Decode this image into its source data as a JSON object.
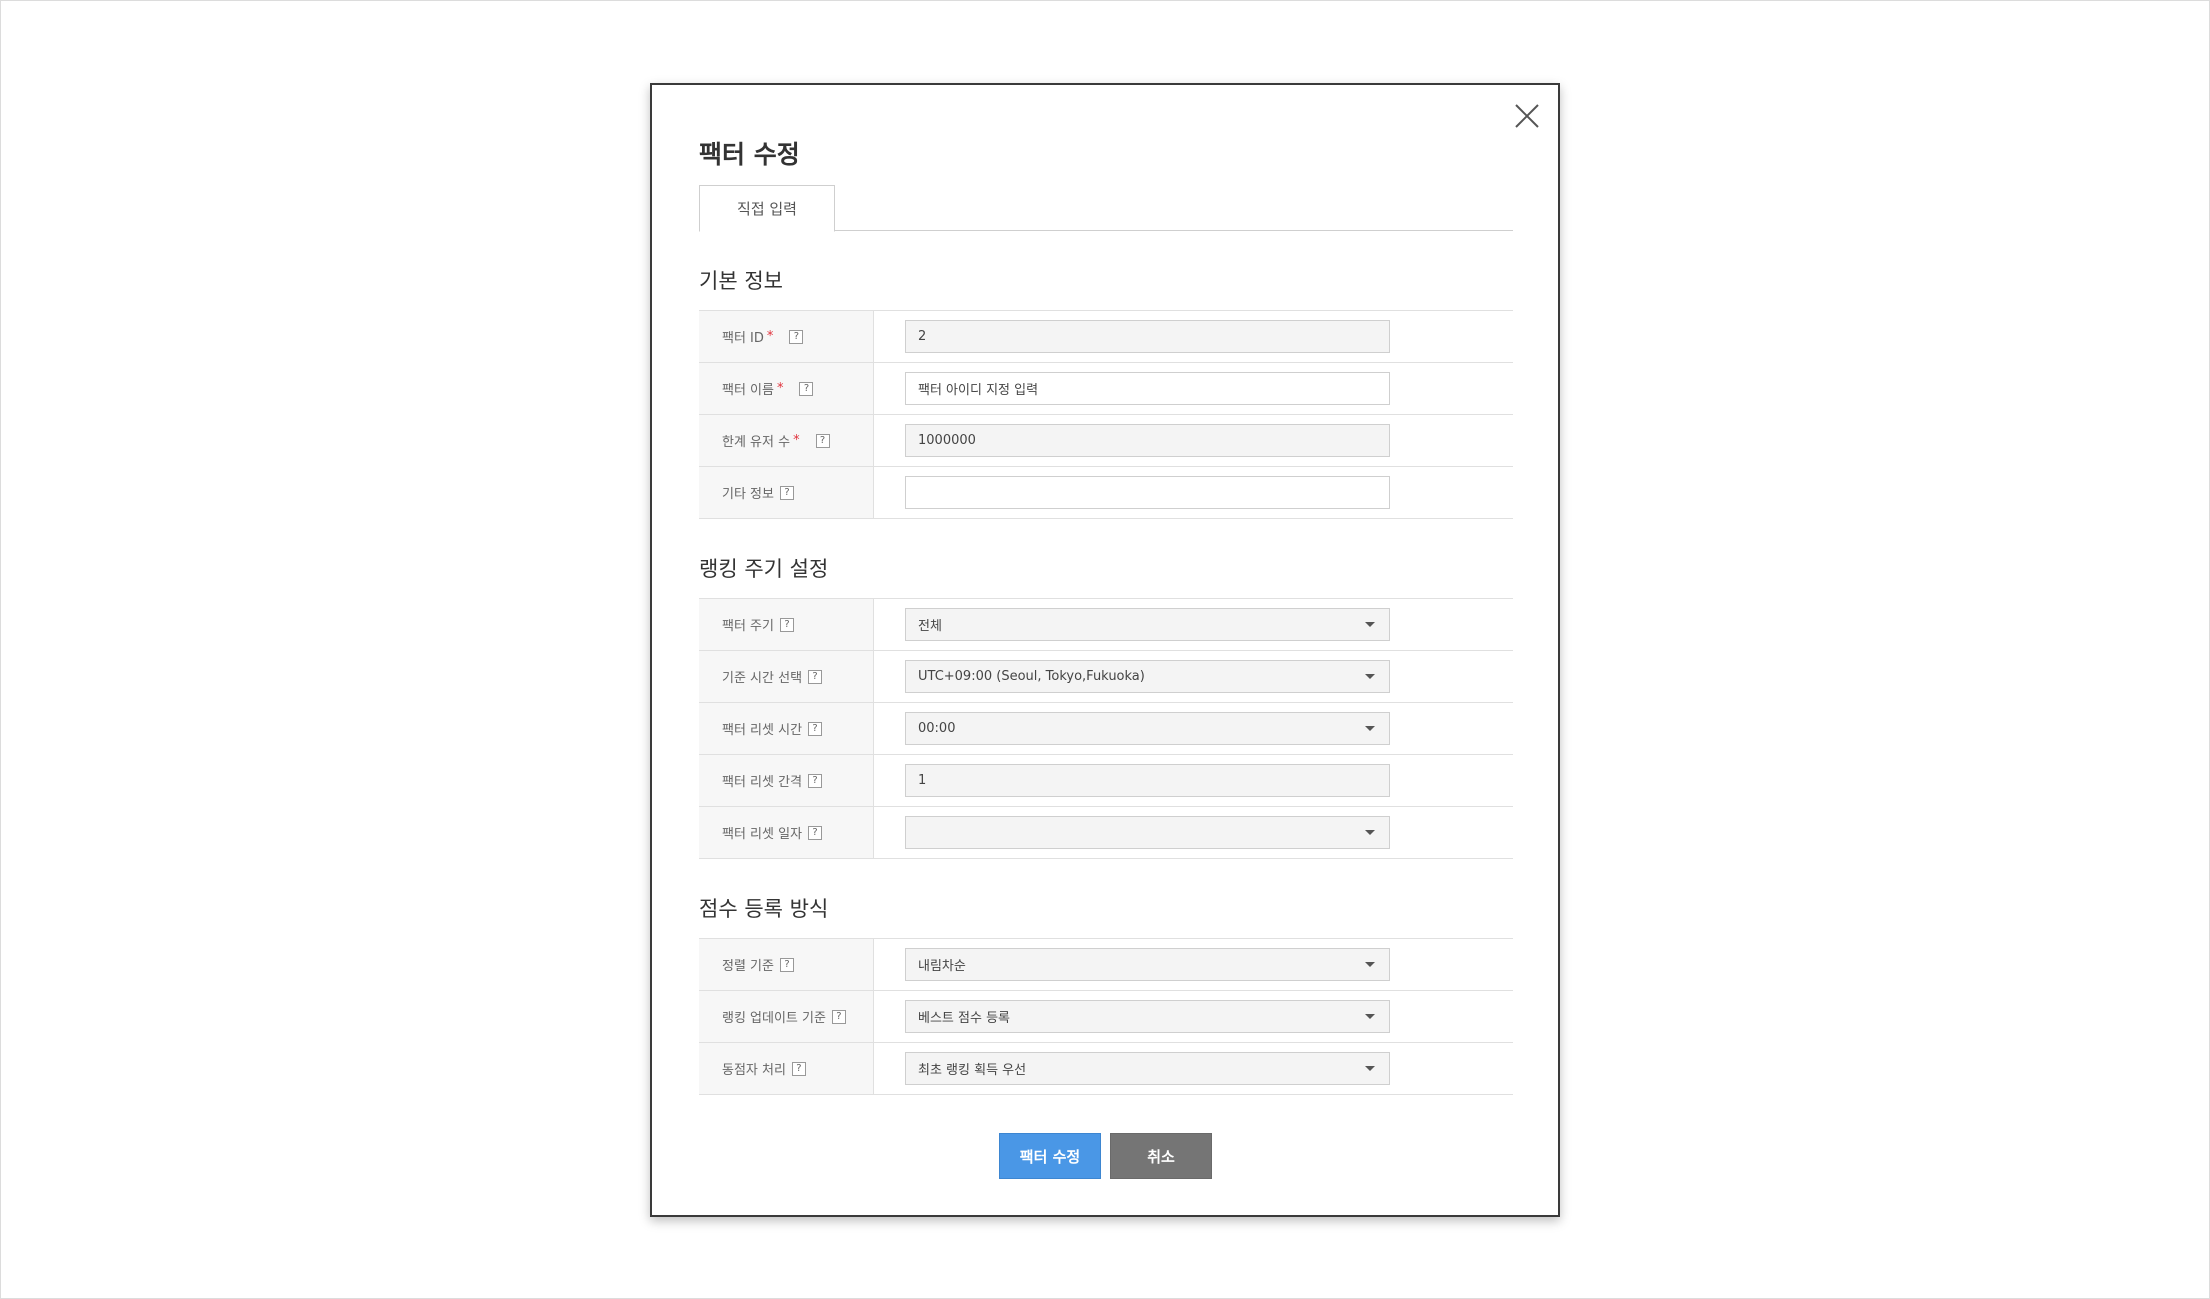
{
  "modal": {
    "title": "팩터 수정",
    "tab_label": "직접 입력",
    "help_symbol": "?",
    "required_mark": "*"
  },
  "sections": {
    "basic": {
      "title": "기본 정보",
      "factor_id": {
        "label": "팩터 ID",
        "value": "2"
      },
      "factor_name": {
        "label": "팩터 이름",
        "value": "팩터 아이디 지정 입력"
      },
      "user_limit": {
        "label": "한계 유저 수",
        "value": "1000000"
      },
      "extra_info": {
        "label": "기타 정보",
        "value": ""
      }
    },
    "ranking": {
      "title": "랭킹 주기 설정",
      "factor_cycle": {
        "label": "팩터 주기",
        "value": "전체"
      },
      "timezone": {
        "label": "기준 시간 선택",
        "value": "UTC+09:00 (Seoul, Tokyo,Fukuoka)"
      },
      "reset_time": {
        "label": "팩터 리셋 시간",
        "value": "00:00"
      },
      "reset_interval": {
        "label": "팩터 리셋 간격",
        "value": "1"
      },
      "reset_day": {
        "label": "팩터 리셋 일자",
        "value": ""
      }
    },
    "score": {
      "title": "점수 등록 방식",
      "sort_order": {
        "label": "정렬 기준",
        "value": "내림차순"
      },
      "update_rule": {
        "label": "랭킹 업데이트 기준",
        "value": "베스트 점수 등록"
      },
      "tie_rule": {
        "label": "동점자 처리",
        "value": "최초 랭킹 획득 우선"
      }
    }
  },
  "buttons": {
    "submit": "팩터 수정",
    "cancel": "취소"
  },
  "colors": {
    "primary": "#4a97e6",
    "cancel": "#757575",
    "required": "#e0303a"
  }
}
